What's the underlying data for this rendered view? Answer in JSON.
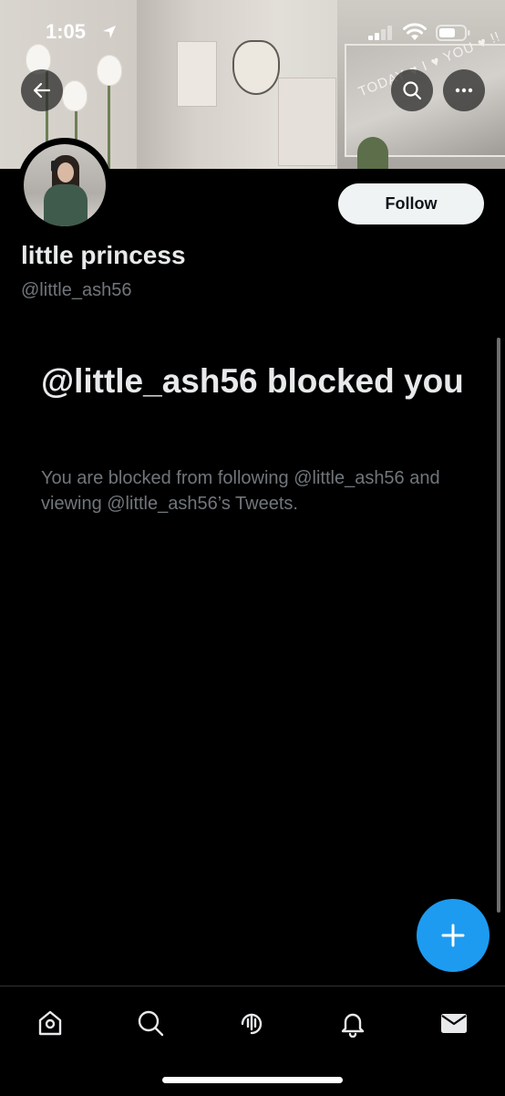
{
  "status_bar": {
    "time": "1:05"
  },
  "banner": {
    "mirror_text": "TODAY ♥ I ♥ YOU ♥ !!",
    "icons": [
      "back-arrow-icon",
      "search-icon",
      "more-options-icon"
    ]
  },
  "profile": {
    "display_name": "little princess",
    "handle": "@little_ash56",
    "follow_label": "Follow"
  },
  "blocked": {
    "title": "@little_ash56 blocked you",
    "message": "You are blocked from following @little_ash56 and viewing @little_ash56’s Tweets."
  },
  "tab_bar": {
    "icons": [
      "home-icon",
      "search-icon",
      "spaces-icon",
      "notifications-bell-icon",
      "messages-envelope-icon"
    ]
  },
  "colors": {
    "background": "#000000",
    "accent": "#1d9bf0",
    "primary_text": "#e7e9ea",
    "secondary_text": "#71767b",
    "follow_button_bg": "#eff3f4"
  }
}
